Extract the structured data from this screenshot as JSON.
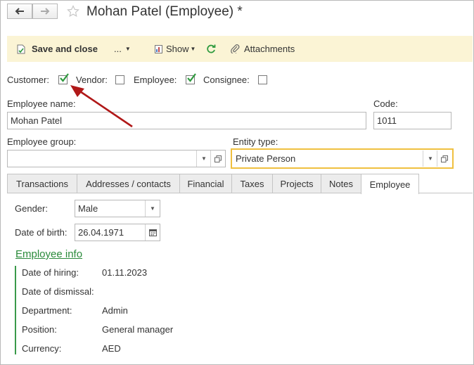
{
  "window": {
    "title": "Mohan Patel (Employee) *",
    "back_icon": "arrow-left-icon",
    "forward_icon": "arrow-right-icon",
    "favorite_icon": "star-icon"
  },
  "toolbar": {
    "save_and_close": "Save and close",
    "more": "...",
    "show": "Show",
    "attachments": "Attachments"
  },
  "roles": {
    "customer": {
      "label": "Customer:",
      "checked": true
    },
    "vendor": {
      "label": "Vendor:",
      "checked": false
    },
    "employee": {
      "label": "Employee:",
      "checked": true
    },
    "consignee": {
      "label": "Consignee:",
      "checked": false
    }
  },
  "fields": {
    "employee_name": {
      "label": "Employee name:",
      "value": "Mohan Patel"
    },
    "code": {
      "label": "Code:",
      "value": "1011"
    },
    "employee_group": {
      "label": "Employee group:",
      "value": ""
    },
    "entity_type": {
      "label": "Entity type:",
      "value": "Private Person"
    }
  },
  "tabs": [
    "Transactions",
    "Addresses / contacts",
    "Financial",
    "Taxes",
    "Projects",
    "Notes",
    "Employee"
  ],
  "active_tab": "Employee",
  "employee_tab": {
    "gender": {
      "label": "Gender:",
      "value": "Male"
    },
    "date_of_birth": {
      "label": "Date of birth:",
      "value": "26.04.1971"
    },
    "info_title": "Employee info",
    "info": {
      "hiring": {
        "label": "Date of hiring:",
        "value": "01.11.2023"
      },
      "dismissal": {
        "label": "Date of dismissal:",
        "value": ""
      },
      "department": {
        "label": "Department:",
        "value": "Admin"
      },
      "position": {
        "label": "Position:",
        "value": "General manager"
      },
      "currency": {
        "label": "Currency:",
        "value": "AED"
      }
    }
  },
  "colors": {
    "toolbar_bg": "#fbf4d5",
    "focus_border": "#f0c040",
    "link_green": "#2a8a3a",
    "check_green": "#2e9a3e",
    "annotation_arrow": "#b01818"
  }
}
